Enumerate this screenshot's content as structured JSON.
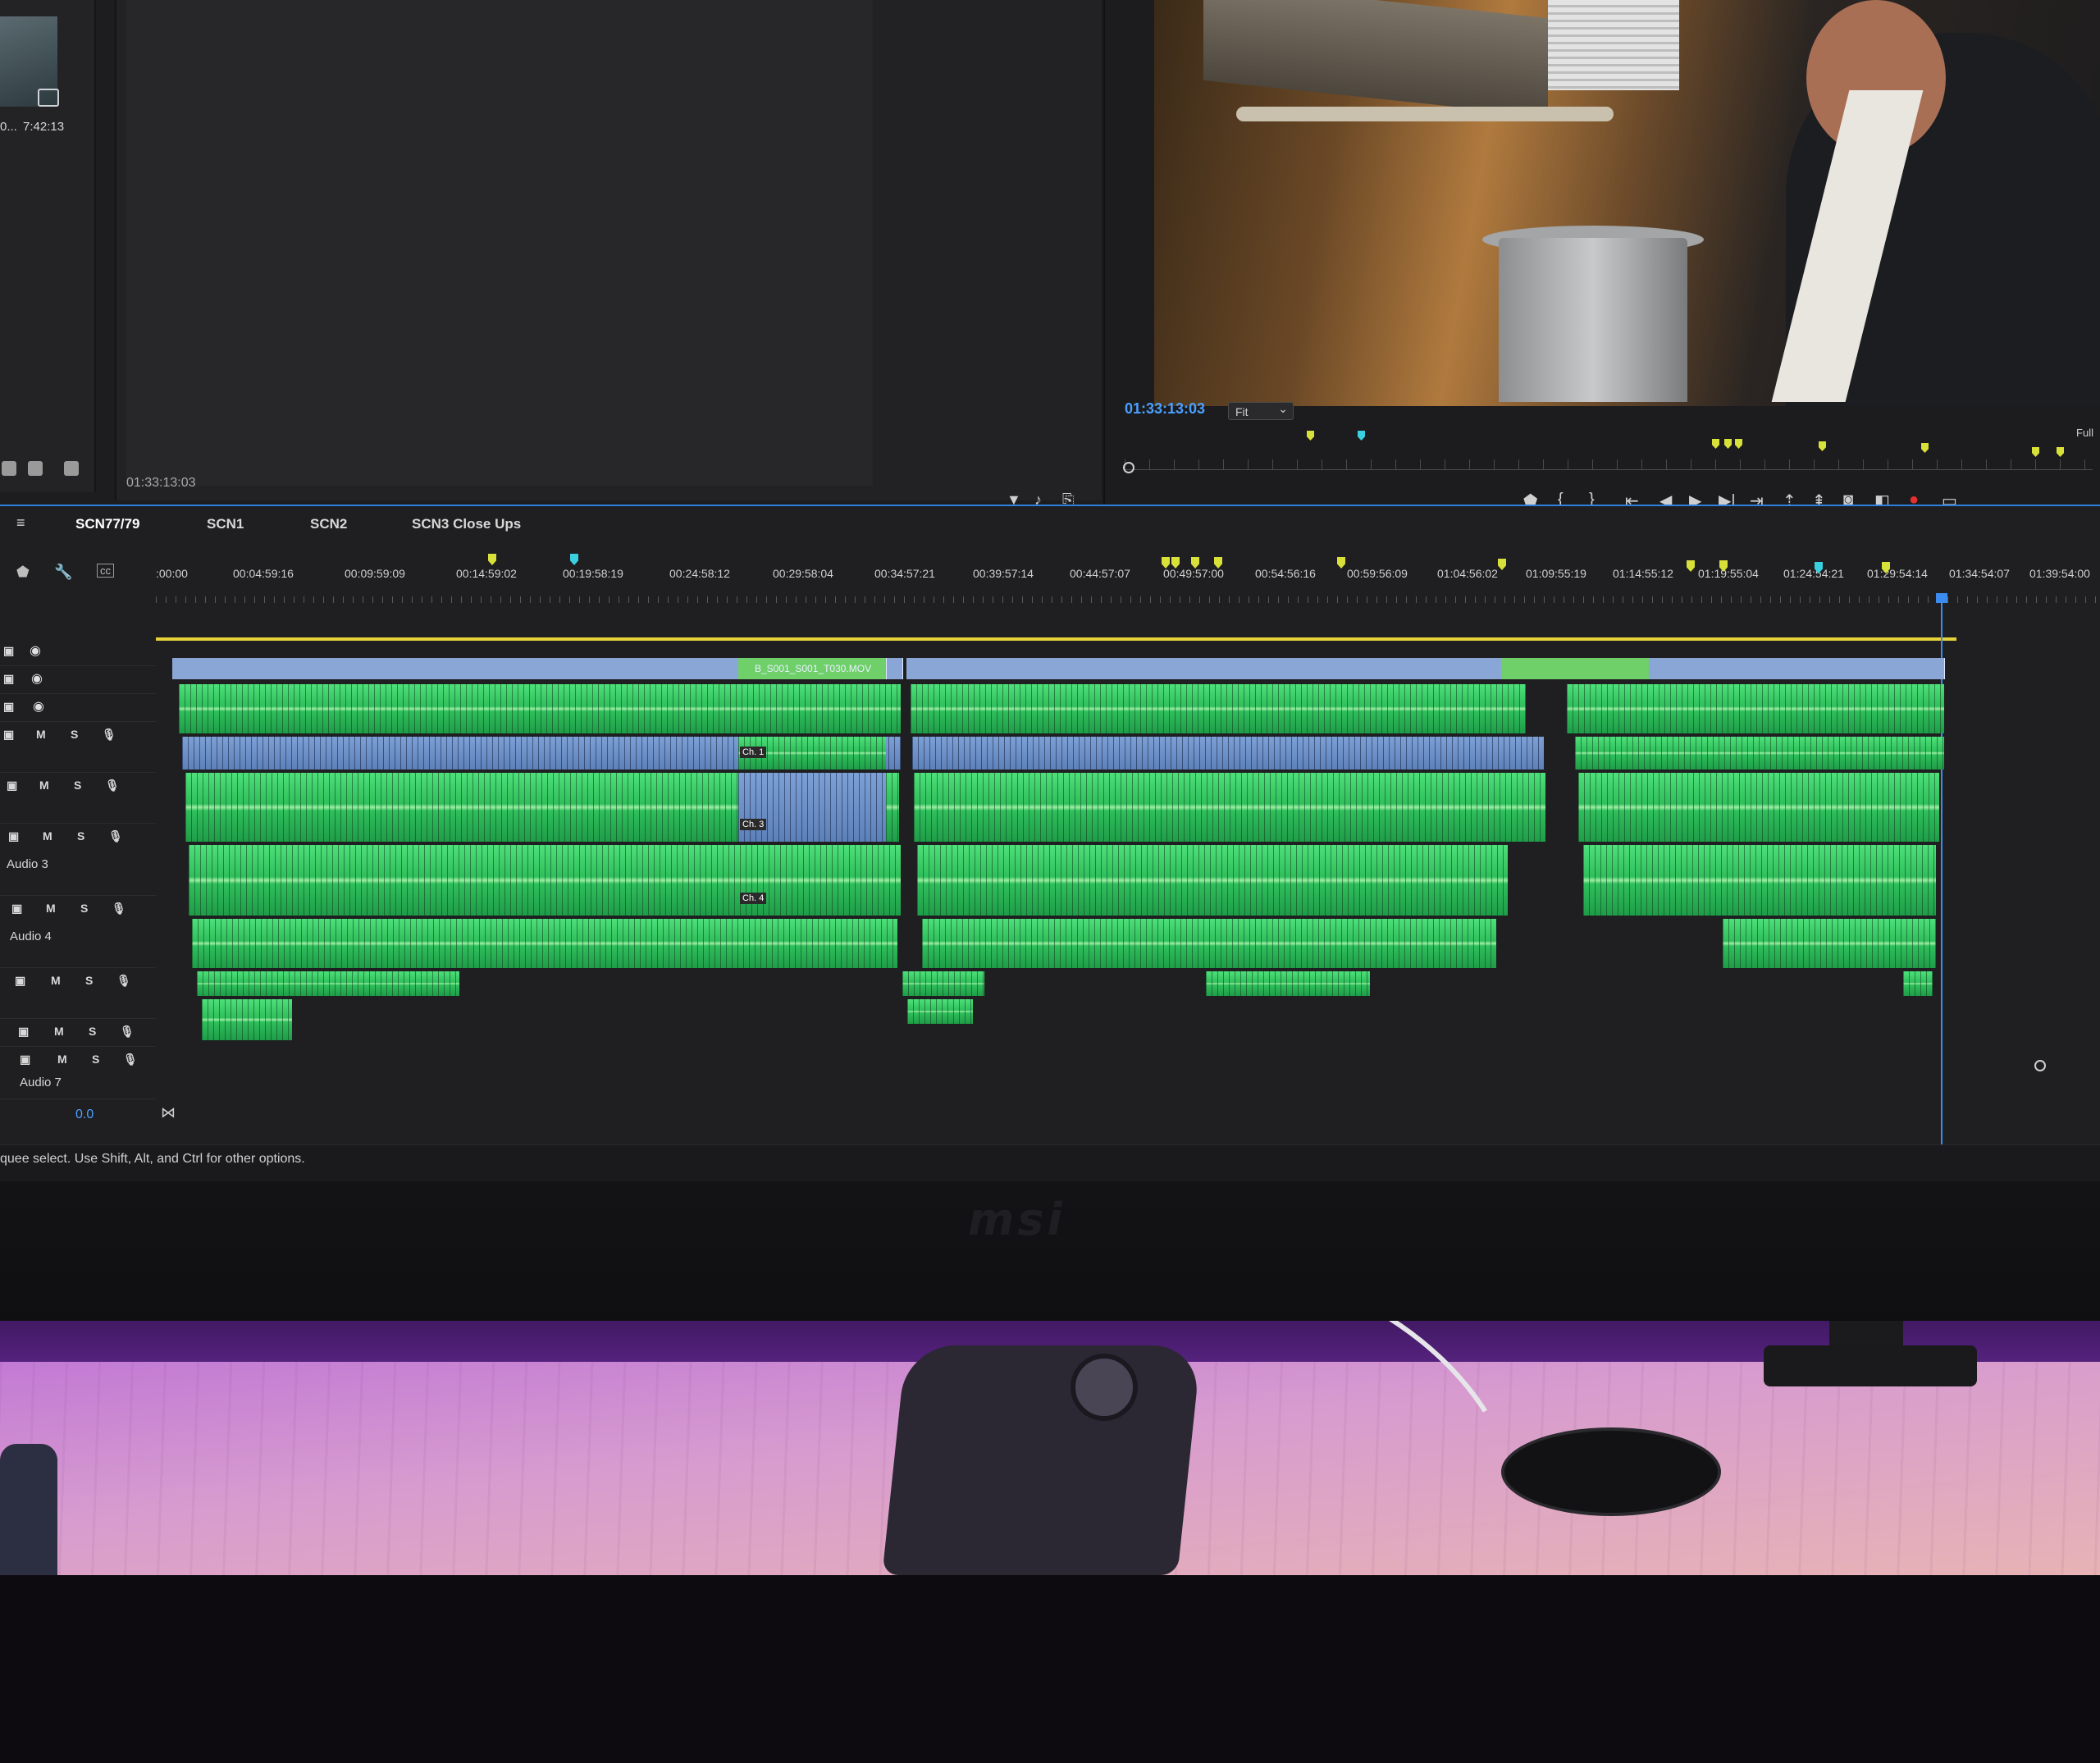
{
  "project": {
    "thumb_name": "0...",
    "thumb_duration": "7:42:13"
  },
  "source_monitor": {
    "timecode": "01:33:13:03"
  },
  "program_monitor": {
    "timecode": "01:33:13:03",
    "fit": "Fit",
    "resolution": "Full"
  },
  "sequence_tabs": [
    {
      "label": "SCN77/79"
    },
    {
      "label": "SCN1"
    },
    {
      "label": "SCN2"
    },
    {
      "label": "SCN3 Close Ups"
    }
  ],
  "ruler": {
    "ticks": [
      ":00:00",
      "00:04:59:16",
      "00:09:59:09",
      "00:14:59:02",
      "00:19:58:19",
      "00:24:58:12",
      "00:29:58:04",
      "00:34:57:21",
      "00:39:57:14",
      "00:44:57:07",
      "00:49:57:00",
      "00:54:56:16",
      "00:59:56:09",
      "01:04:56:02",
      "01:09:55:19",
      "01:14:55:12",
      "01:19:55:04",
      "01:24:54:21",
      "01:29:54:14",
      "01:34:54:07",
      "01:39:54:00"
    ]
  },
  "tracks": {
    "audio_names": [
      "Audio 3",
      "Audio 4",
      "Audio 7"
    ],
    "mute_label": "M",
    "solo_label": "S"
  },
  "clip": {
    "name": "B_S001_S001_T030.MOV",
    "channels": [
      "Ch. 1",
      "Ch. 3",
      "Ch. 4"
    ]
  },
  "timeline_footer": {
    "zoom": "0.0"
  },
  "status": {
    "text": "quee select. Use Shift, Alt, and Ctrl for other options."
  },
  "colors": {
    "accent": "#2f7fdc",
    "timecode": "#4aa0ff",
    "audio_clip": "#3fd06a",
    "video_clip": "#8aa6d6",
    "marker_yellow": "#d8e03a",
    "marker_cyan": "#3ad0e0",
    "work_area": "#e7d23a"
  }
}
